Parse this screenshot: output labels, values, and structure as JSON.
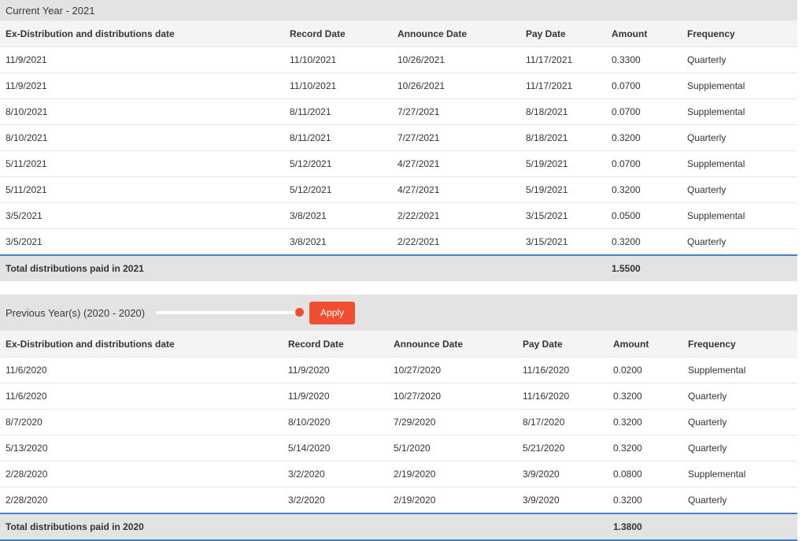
{
  "current": {
    "header": "Current Year - 2021",
    "columns": [
      "Ex-Distribution and distributions date",
      "Record Date",
      "Announce Date",
      "Pay Date",
      "Amount",
      "Frequency"
    ],
    "rows": [
      [
        "11/9/2021",
        "11/10/2021",
        "10/26/2021",
        "11/17/2021",
        "0.3300",
        "Quarterly"
      ],
      [
        "11/9/2021",
        "11/10/2021",
        "10/26/2021",
        "11/17/2021",
        "0.0700",
        "Supplemental"
      ],
      [
        "8/10/2021",
        "8/11/2021",
        "7/27/2021",
        "8/18/2021",
        "0.0700",
        "Supplemental"
      ],
      [
        "8/10/2021",
        "8/11/2021",
        "7/27/2021",
        "8/18/2021",
        "0.3200",
        "Quarterly"
      ],
      [
        "5/11/2021",
        "5/12/2021",
        "4/27/2021",
        "5/19/2021",
        "0.0700",
        "Supplemental"
      ],
      [
        "5/11/2021",
        "5/12/2021",
        "4/27/2021",
        "5/19/2021",
        "0.3200",
        "Quarterly"
      ],
      [
        "3/5/2021",
        "3/8/2021",
        "2/22/2021",
        "3/15/2021",
        "0.0500",
        "Supplemental"
      ],
      [
        "3/5/2021",
        "3/8/2021",
        "2/22/2021",
        "3/15/2021",
        "0.3200",
        "Quarterly"
      ]
    ],
    "total_label": "Total distributions paid in 2021",
    "total_value": "1.5500"
  },
  "previous": {
    "header": "Previous Year(s) (2020 - 2020)",
    "slider_value": 2020,
    "apply_label": "Apply",
    "columns": [
      "Ex-Distribution and distributions date",
      "Record Date",
      "Announce Date",
      "Pay Date",
      "Amount",
      "Frequency"
    ],
    "rows": [
      [
        "11/6/2020",
        "11/9/2020",
        "10/27/2020",
        "11/16/2020",
        "0.0200",
        "Supplemental"
      ],
      [
        "11/6/2020",
        "11/9/2020",
        "10/27/2020",
        "11/16/2020",
        "0.3200",
        "Quarterly"
      ],
      [
        "8/7/2020",
        "8/10/2020",
        "7/29/2020",
        "8/17/2020",
        "0.3200",
        "Quarterly"
      ],
      [
        "5/13/2020",
        "5/14/2020",
        "5/1/2020",
        "5/21/2020",
        "0.3200",
        "Quarterly"
      ],
      [
        "2/28/2020",
        "3/2/2020",
        "2/19/2020",
        "3/9/2020",
        "0.0800",
        "Supplemental"
      ],
      [
        "2/28/2020",
        "3/2/2020",
        "2/19/2020",
        "3/9/2020",
        "0.3200",
        "Quarterly"
      ]
    ],
    "total_label": "Total distributions paid in 2020",
    "total_value": "1.3800"
  },
  "colors": {
    "accent": "#f04e30",
    "total_border": "#4a7fc1",
    "header_bg": "#e3e3e3"
  }
}
